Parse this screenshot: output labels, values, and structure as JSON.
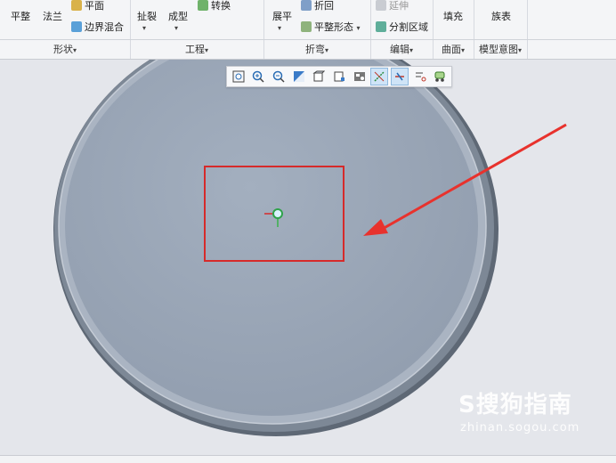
{
  "ribbon": {
    "group_shape": {
      "label": "形状",
      "buttons": {
        "flat": "平整",
        "flange": "法兰",
        "plane": "平面",
        "boundary_blend": "边界混合"
      }
    },
    "group_engineering": {
      "label": "工程",
      "buttons": {
        "rip": "扯裂",
        "form": "成型",
        "convert": "转换"
      }
    },
    "group_bend": {
      "label": "折弯",
      "buttons": {
        "unbend": "展平",
        "bend_back": "折回",
        "flat_pattern": "平整形态"
      }
    },
    "group_edit": {
      "label": "编辑",
      "buttons": {
        "extend": "延伸",
        "split_area": "分割区域"
      }
    },
    "group_surface": {
      "label": "曲面",
      "buttons": {
        "fill": "填充"
      }
    },
    "group_model_intent": {
      "label": "模型意图",
      "buttons": {
        "family_table": "族表"
      }
    },
    "dropdown_glyph": "▾"
  },
  "view_toolbar": {
    "icons": [
      "refit-icon",
      "zoom-in-icon",
      "zoom-out-icon",
      "repaint-icon",
      "display-style-icon",
      "saved-orientations-icon",
      "view-manager-icon",
      "plane-display-icon",
      "axis-display-icon",
      "point-display-icon",
      "csys-display-icon"
    ],
    "active": [
      "plane-display-icon",
      "axis-display-icon"
    ]
  },
  "colors": {
    "model_fill": "#9aa6b6",
    "model_rim": "#6f7a88",
    "background": "#e4e6eb",
    "highlight_box": "#d62a2a",
    "arrow": "#e8322d"
  },
  "watermark": {
    "brand": "S搜狗指南",
    "url": "zhinan.sogou.com"
  }
}
